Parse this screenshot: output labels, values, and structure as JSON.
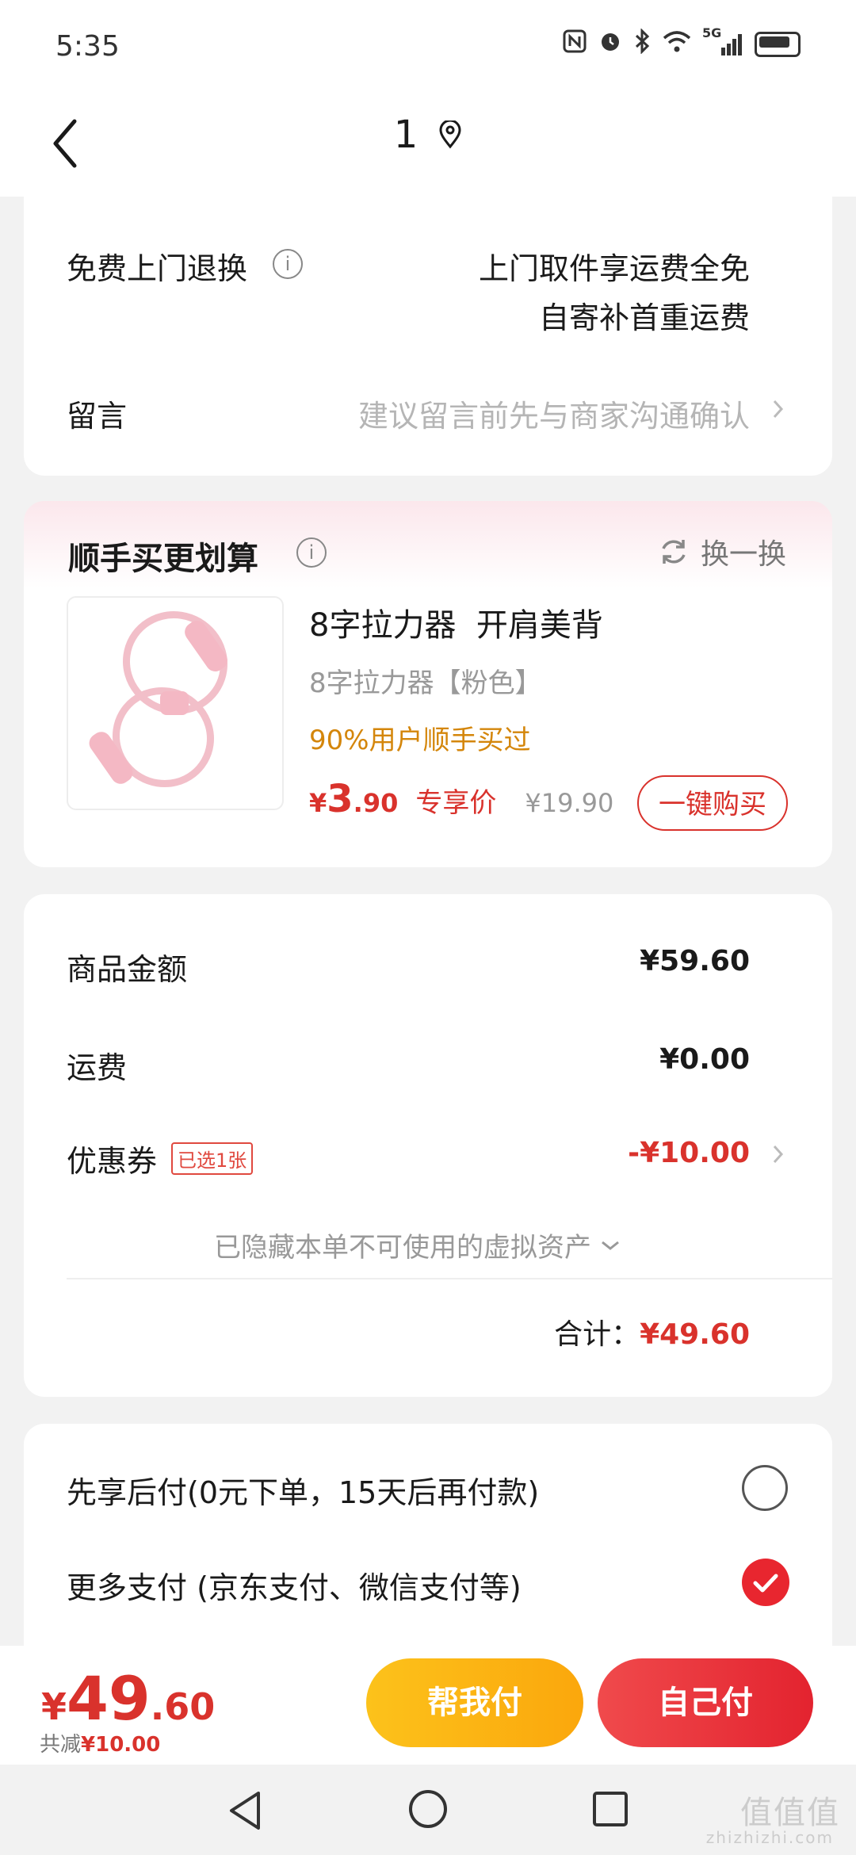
{
  "status_bar": {
    "time": "5:35",
    "network": "5G",
    "icons": [
      "nfc-icon",
      "alarm-icon",
      "bluetooth-icon",
      "wifi-icon",
      "signal-icon",
      "battery-icon"
    ]
  },
  "header": {
    "title": "1",
    "location_icon": "location-pin-icon"
  },
  "service": {
    "return_label": "免费上门退换",
    "return_line1": "上门取件享运费全免",
    "return_line2": "自寄补首重运费",
    "message_label": "留言",
    "message_placeholder": "建议留言前先与商家沟通确认"
  },
  "bundle": {
    "title": "顺手买更划算",
    "swap_label": "换一换",
    "product_name": "8字拉力器  开肩美背",
    "product_variant": "8字拉力器【粉色】",
    "social_proof": "90%用户顺手买过",
    "price_symbol": "¥",
    "price_int": "3",
    "price_dec": ".90",
    "price_tag": "专享价",
    "original_price": "¥19.90",
    "buy_label": "一键购买"
  },
  "summary": {
    "goods_label": "商品金额",
    "goods_value": "¥59.60",
    "shipping_label": "运费",
    "shipping_value": "¥0.00",
    "coupon_label": "优惠券",
    "coupon_tag": "已选1张",
    "coupon_value": "-¥10.00",
    "hidden_assets": "已隐藏本单不可使用的虚拟资产",
    "total_label": "合计：",
    "total_value": "¥49.60"
  },
  "payment": {
    "option1": "先享后付(0元下单，15天后再付款)",
    "option1_selected": false,
    "option2": "更多支付 (京东支付、微信支付等)",
    "option2_selected": true
  },
  "bottom_bar": {
    "price_symbol": "¥",
    "price_int": "49",
    "price_dec": ".60",
    "discount_label": "共减",
    "discount_value": "¥10.00",
    "help_pay": "帮我付",
    "self_pay": "自己付"
  },
  "watermark": {
    "text": "值值值",
    "sub": "zhizhizhi.com"
  },
  "colors": {
    "accent_red": "#e3232f",
    "price_red": "#d9322c",
    "gold": "#d4860b",
    "help_yellow": "#fcc21b"
  }
}
